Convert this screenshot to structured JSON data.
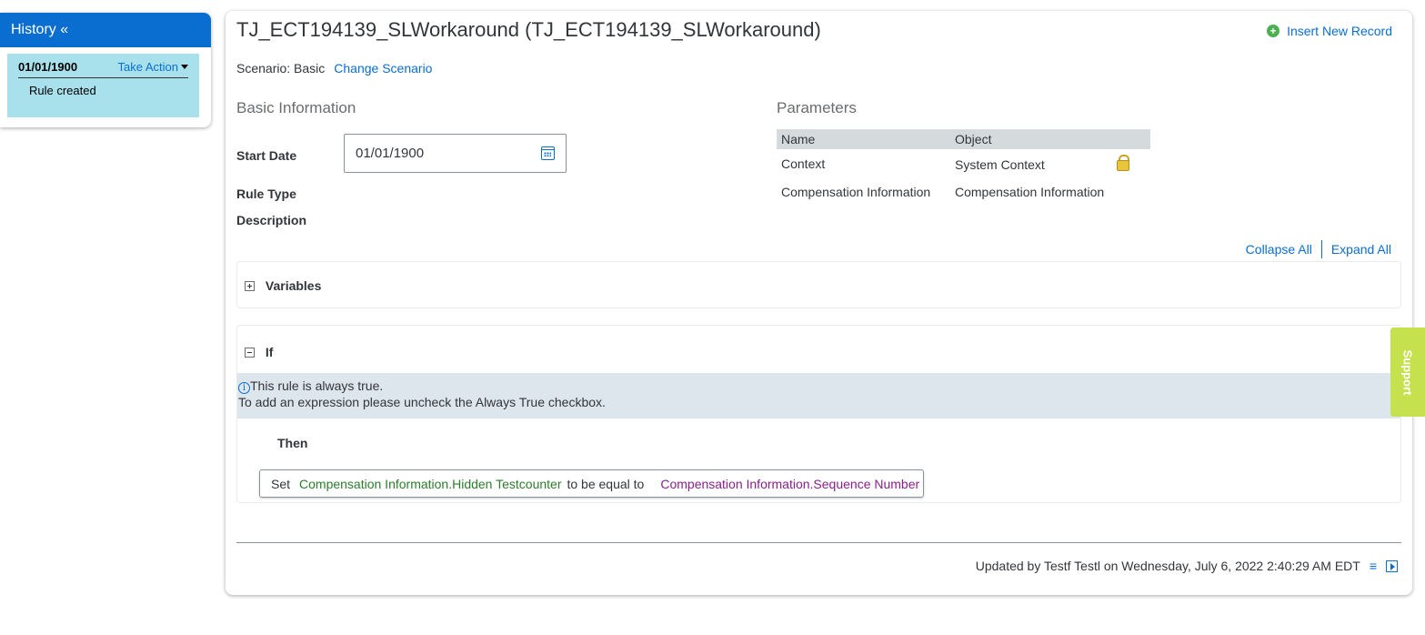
{
  "history": {
    "title": "History «",
    "entries": [
      {
        "date": "01/01/1900",
        "action_label": "Take Action",
        "note": "Rule created"
      }
    ]
  },
  "rule": {
    "title": "TJ_ECT194139_SLWorkaround (TJ_ECT194139_SLWorkaround)",
    "insert_label": "Insert New Record",
    "scenario_label": "Scenario: Basic",
    "change_scenario_label": "Change Scenario"
  },
  "basic_info": {
    "heading": "Basic Information",
    "start_date_label": "Start Date",
    "start_date_value": "01/01/1900",
    "rule_type_label": "Rule Type",
    "description_label": "Description"
  },
  "parameters": {
    "heading": "Parameters",
    "columns": [
      "Name",
      "Object"
    ],
    "rows": [
      {
        "name": "Context",
        "object": "System Context",
        "locked": true
      },
      {
        "name": "Compensation Information",
        "object": "Compensation Information",
        "locked": false
      }
    ]
  },
  "controls": {
    "collapse_all": "Collapse All",
    "expand_all": "Expand All"
  },
  "variables_block": {
    "title": "Variables"
  },
  "if_block": {
    "title": "If",
    "info_line1": "This rule is always true.",
    "info_line2": "To add an expression please uncheck the Always True checkbox.",
    "then_label": "Then",
    "expression": {
      "verb": "Set",
      "target": "Compensation Information.Hidden Testcounter",
      "operator": "to be equal to",
      "source": "Compensation Information.Sequence Number"
    }
  },
  "footer": {
    "updated_text": "Updated by Testf Testl on Wednesday, July 6, 2022 2:40:29 AM EDT"
  },
  "support_label": "Support",
  "colors": {
    "brand_blue": "#0a6ed1",
    "history_entry_bg": "#a8e1ec",
    "support_bg": "#c5e24e",
    "target_green": "#2b7d2b",
    "source_purple": "#8a1f8a"
  }
}
